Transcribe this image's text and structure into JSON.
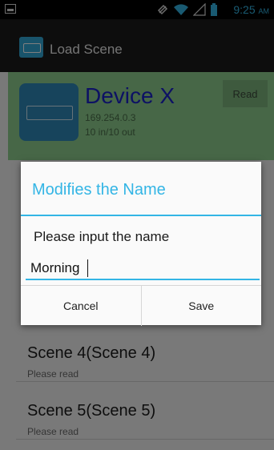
{
  "status_bar": {
    "time": "9:25",
    "ampm": "AM"
  },
  "action_bar": {
    "title": "Load Scene"
  },
  "device": {
    "name": "Device X",
    "ip": "169.254.0.3",
    "io": "10 in/10 out",
    "read_label": "Read"
  },
  "scenes": [
    {
      "title": "Scene 4(Scene 4)",
      "subtitle": "Please read"
    },
    {
      "title": "Scene 5(Scene 5)",
      "subtitle": "Please read"
    }
  ],
  "dialog": {
    "title": "Modifies the Name",
    "message": "Please input the name",
    "input_value": "Morning",
    "cancel_label": "Cancel",
    "save_label": "Save"
  },
  "colors": {
    "accent": "#33b5e5",
    "device_bg": "#8fcf8f",
    "device_name": "#1a23c8"
  }
}
